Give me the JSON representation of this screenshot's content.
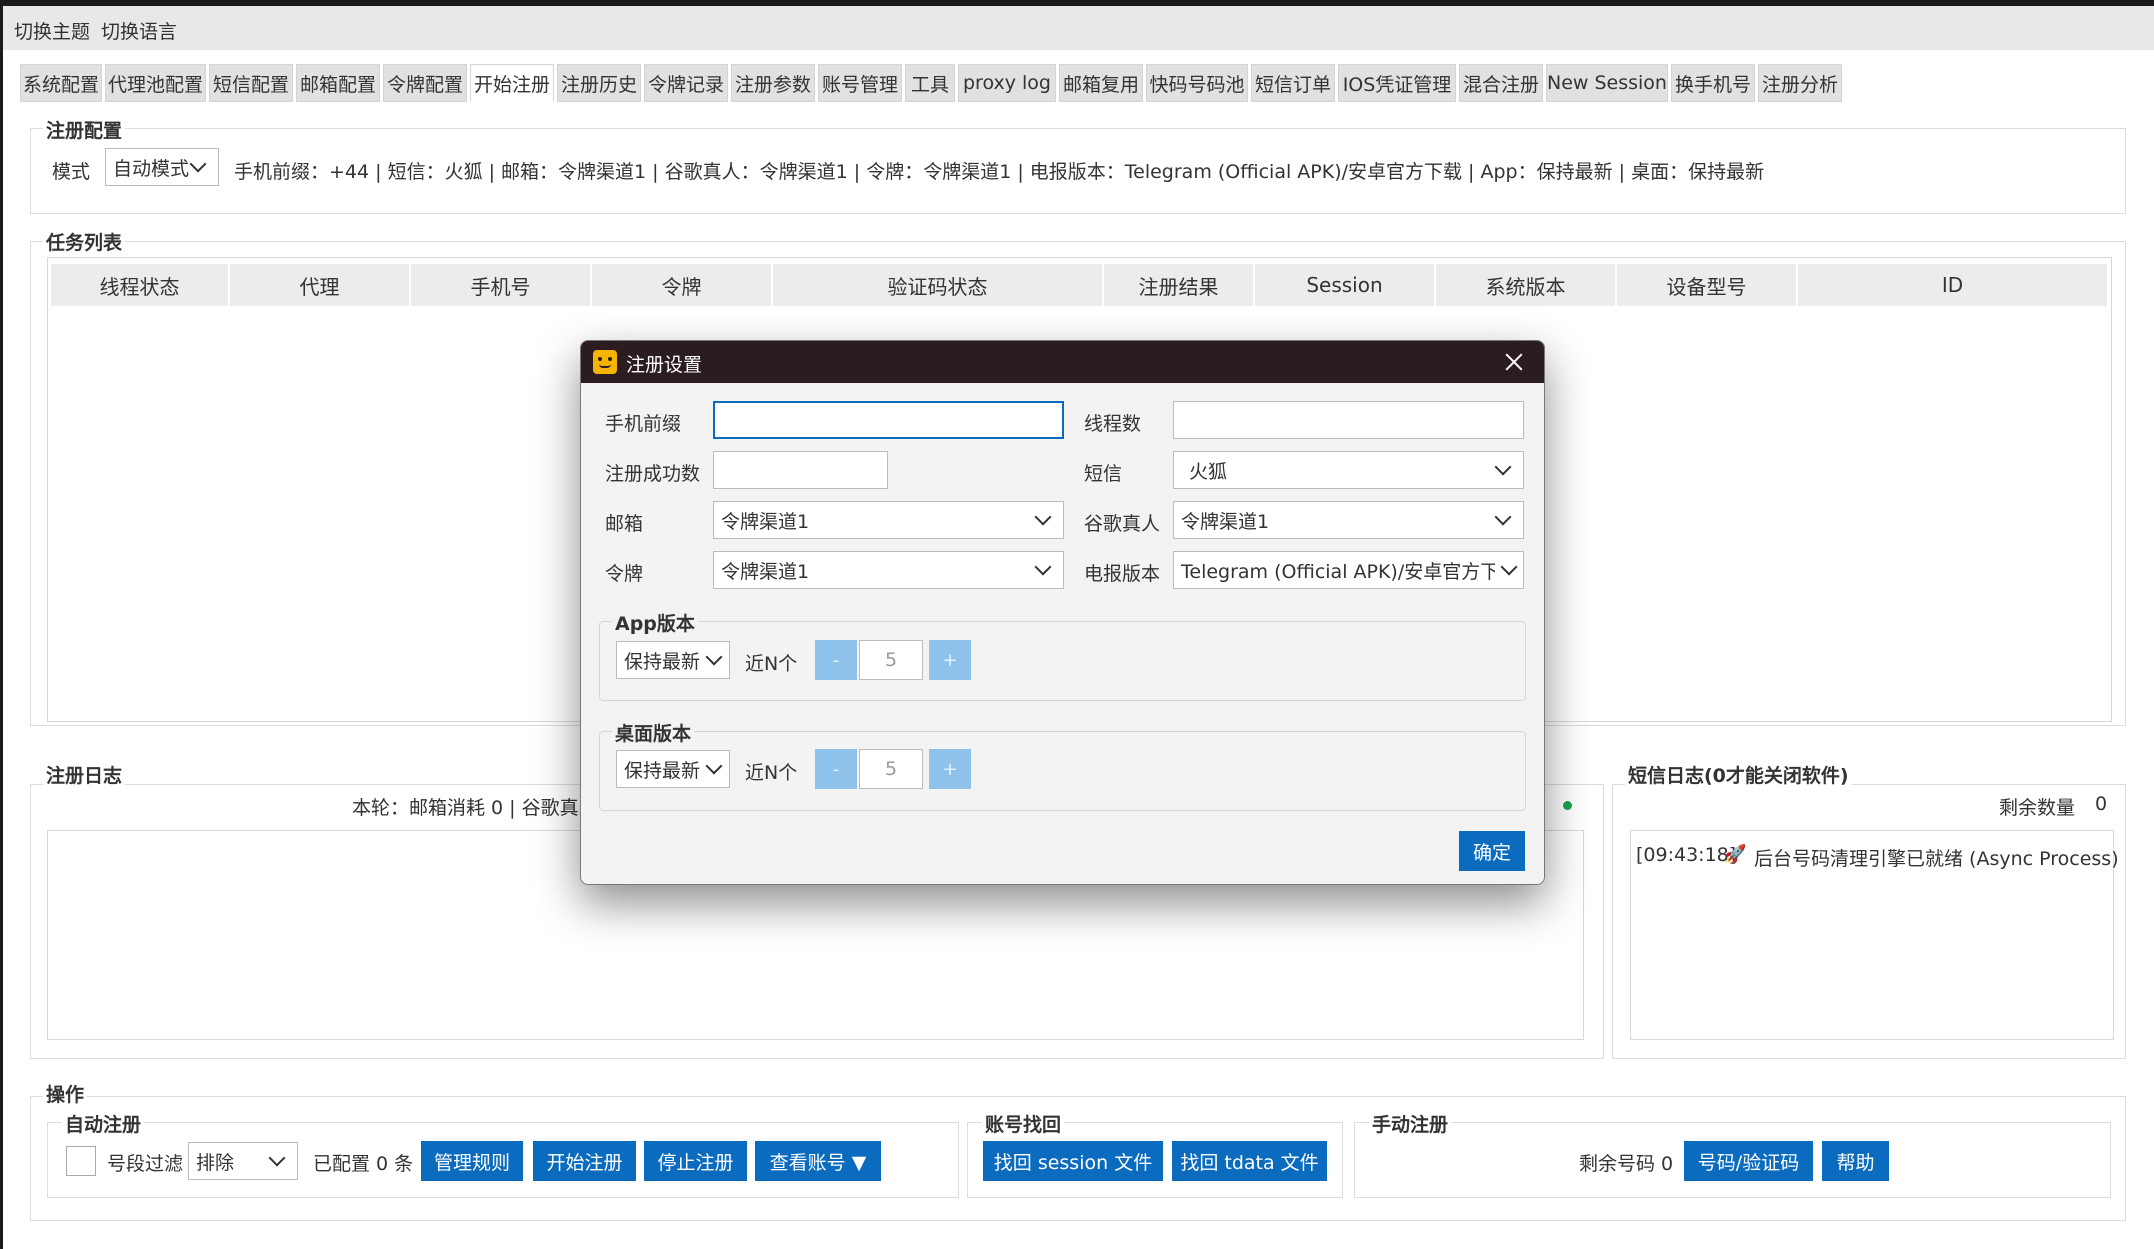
{
  "topbar": {
    "theme": "切换主题",
    "language": "切换语言"
  },
  "tabs": [
    "系统配置",
    "代理池配置",
    "短信配置",
    "邮箱配置",
    "令牌配置",
    "开始注册",
    "注册历史",
    "令牌记录",
    "注册参数",
    "账号管理",
    "工具",
    "proxy log",
    "邮箱复用",
    "快码号码池",
    "短信订单",
    "IOS凭证管理",
    "混合注册",
    "New Session",
    "换手机号",
    "注册分析"
  ],
  "active_tab": "开始注册",
  "reg_config": {
    "title": "注册配置",
    "mode_label": "模式",
    "mode_value": "自动模式",
    "summary": "手机前缀：+44 | 短信：火狐 | 邮箱：令牌渠道1 | 谷歌真人：令牌渠道1 | 令牌：令牌渠道1 | 电报版本：Telegram (Official APK)/安卓官方下载 | App：保持最新 | 桌面：保持最新"
  },
  "task_list": {
    "title": "任务列表",
    "columns": [
      "线程状态",
      "代理",
      "手机号",
      "令牌",
      "验证码状态",
      "注册结果",
      "Session",
      "系统版本",
      "设备型号",
      "ID"
    ]
  },
  "reg_log": {
    "title": "注册日志",
    "stats": "本轮：邮箱消耗 0 | 谷歌真人"
  },
  "sms_log": {
    "title": "短信日志(0才能关闭软件)",
    "remaining_label": "剩余数量",
    "remaining_value": "0",
    "entry_time": "[09:43:18]",
    "entry_icon": "rocket-icon",
    "entry_text": "后台号码清理引擎已就绪 (Async Process)"
  },
  "ops": {
    "title": "操作",
    "auto": {
      "title": "自动注册",
      "filter_label": "号段过滤",
      "filter_value": "排除",
      "configured": "已配置 0 条",
      "btn_rules": "管理规则",
      "btn_start": "开始注册",
      "btn_stop": "停止注册",
      "btn_view": "查看账号 ▼"
    },
    "recover": {
      "title": "账号找回",
      "btn_session": "找回 session 文件",
      "btn_tdata": "找回 tdata 文件"
    },
    "manual": {
      "title": "手动注册",
      "remaining": "剩余号码 0",
      "btn_code": "号码/验证码",
      "btn_help": "帮助"
    }
  },
  "modal": {
    "title": "注册设置",
    "phone_prefix_label": "手机前缀",
    "phone_prefix_value": "",
    "threads_label": "线程数",
    "threads_value": "",
    "success_count_label": "注册成功数",
    "success_count_value": "",
    "sms_label": "短信",
    "sms_value": "火狐",
    "email_label": "邮箱",
    "email_value": "令牌渠道1",
    "google_label": "谷歌真人",
    "google_value": "令牌渠道1",
    "token_label": "令牌",
    "token_value": "令牌渠道1",
    "tg_version_label": "电报版本",
    "tg_version_value": "Telegram (Official APK)/安卓官方下载",
    "app_version": {
      "title": "App版本",
      "mode": "保持最新",
      "recent_label": "近N个",
      "minus": "-",
      "value": "5",
      "plus": "+"
    },
    "desktop_version": {
      "title": "桌面版本",
      "mode": "保持最新",
      "recent_label": "近N个",
      "minus": "-",
      "value": "5",
      "plus": "+"
    },
    "ok": "确定",
    "colors": {
      "titlebar": "#2b1d1f",
      "accent": "#0b6bbf",
      "step": "#8ec2ea"
    }
  }
}
